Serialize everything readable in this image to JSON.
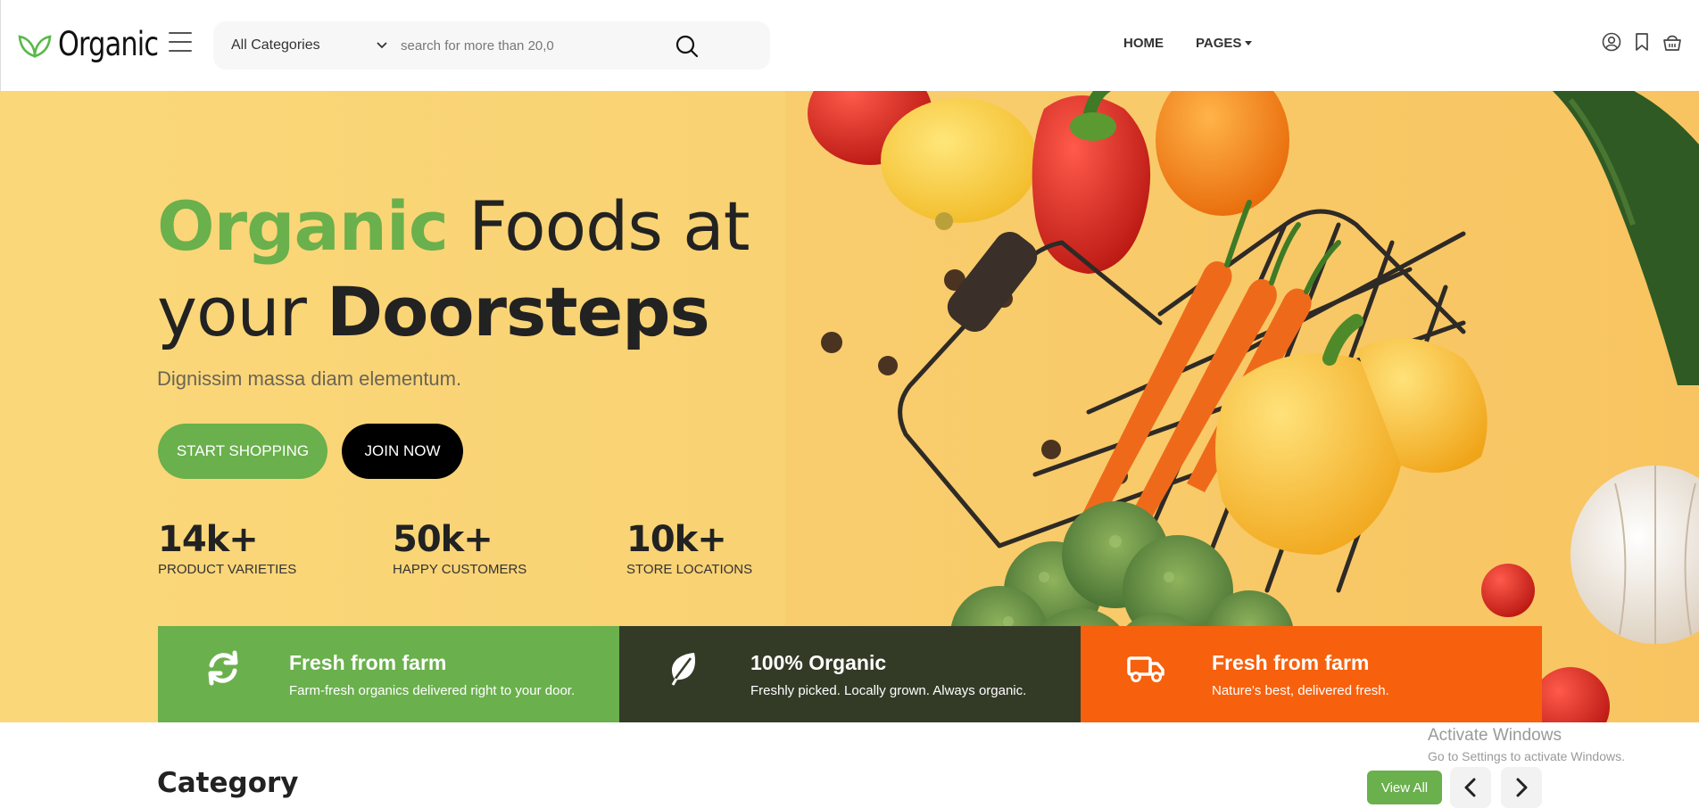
{
  "header": {
    "logo_text": "Organic",
    "category_select": "All Categories",
    "search_placeholder": "search for more than 20,0",
    "nav": {
      "home": "HOME",
      "pages": "PAGES"
    }
  },
  "hero": {
    "title_green": "Organic",
    "title_rest_line1": " Foods at",
    "title_line2_a": "your ",
    "title_line2_b": "Doorsteps",
    "subtitle": "Dignissim massa diam elementum.",
    "start_button": "START SHOPPING",
    "join_button": "JOIN NOW",
    "stats": [
      {
        "value": "14k+",
        "label": "PRODUCT VARIETIES"
      },
      {
        "value": "50k+",
        "label": "HAPPY CUSTOMERS"
      },
      {
        "value": "10k+",
        "label": "STORE LOCATIONS"
      }
    ]
  },
  "features": [
    {
      "title": "Fresh from farm",
      "desc": "Farm-fresh organics delivered right to your door.",
      "color": "#6ab04c",
      "icon": "refresh-icon"
    },
    {
      "title": "100% Organic",
      "desc": "Freshly picked. Locally grown. Always organic.",
      "color": "#333b27",
      "icon": "leaf-icon"
    },
    {
      "title": "Fresh from farm",
      "desc": "Nature's best, delivered fresh.",
      "color": "#f7600c",
      "icon": "truck-icon"
    }
  ],
  "category": {
    "title": "Category",
    "view_all": "View All"
  },
  "watermark": {
    "line1": "Activate Windows",
    "line2": "Go to Settings to activate Windows."
  },
  "colors": {
    "brand_green": "#6ab04c",
    "hero_bg": "#f9d273",
    "dark": "#333b27",
    "orange": "#f7600c"
  }
}
